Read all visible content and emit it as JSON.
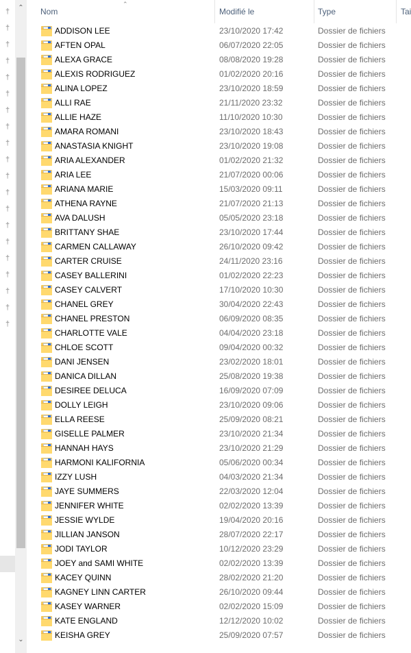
{
  "header": {
    "name": "Nom",
    "modified": "Modifié le",
    "type": "Type",
    "size": "Tail"
  },
  "icons": {
    "pin": "pin-icon",
    "scroll_up": "chevron-up-icon",
    "scroll_down": "chevron-down-icon",
    "folder": "folder-icon",
    "sort": "sort-ascending-icon"
  },
  "rows": [
    {
      "name": "ADDISON LEE",
      "date": "23/10/2020 17:42",
      "type": "Dossier de fichiers"
    },
    {
      "name": "AFTEN OPAL",
      "date": "06/07/2020 22:05",
      "type": "Dossier de fichiers"
    },
    {
      "name": "ALEXA GRACE",
      "date": "08/08/2020 19:28",
      "type": "Dossier de fichiers"
    },
    {
      "name": "ALEXIS RODRIGUEZ",
      "date": "01/02/2020 20:16",
      "type": "Dossier de fichiers"
    },
    {
      "name": "ALINA LOPEZ",
      "date": "23/10/2020 18:59",
      "type": "Dossier de fichiers"
    },
    {
      "name": "ALLI RAE",
      "date": "21/11/2020 23:32",
      "type": "Dossier de fichiers"
    },
    {
      "name": "ALLIE HAZE",
      "date": "11/10/2020 10:30",
      "type": "Dossier de fichiers"
    },
    {
      "name": "AMARA ROMANI",
      "date": "23/10/2020 18:43",
      "type": "Dossier de fichiers"
    },
    {
      "name": "ANASTASIA KNIGHT",
      "date": "23/10/2020 19:08",
      "type": "Dossier de fichiers"
    },
    {
      "name": "ARIA ALEXANDER",
      "date": "01/02/2020 21:32",
      "type": "Dossier de fichiers"
    },
    {
      "name": "ARIA LEE",
      "date": "21/07/2020 00:06",
      "type": "Dossier de fichiers"
    },
    {
      "name": "ARIANA MARIE",
      "date": "15/03/2020 09:11",
      "type": "Dossier de fichiers"
    },
    {
      "name": "ATHENA RAYNE",
      "date": "21/07/2020 21:13",
      "type": "Dossier de fichiers"
    },
    {
      "name": "AVA DALUSH",
      "date": "05/05/2020 23:18",
      "type": "Dossier de fichiers"
    },
    {
      "name": "BRITTANY SHAE",
      "date": "23/10/2020 17:44",
      "type": "Dossier de fichiers"
    },
    {
      "name": "CARMEN CALLAWAY",
      "date": "26/10/2020 09:42",
      "type": "Dossier de fichiers"
    },
    {
      "name": "CARTER CRUISE",
      "date": "24/11/2020 23:16",
      "type": "Dossier de fichiers"
    },
    {
      "name": "CASEY BALLERINI",
      "date": "01/02/2020 22:23",
      "type": "Dossier de fichiers"
    },
    {
      "name": "CASEY CALVERT",
      "date": "17/10/2020 10:30",
      "type": "Dossier de fichiers"
    },
    {
      "name": "CHANEL GREY",
      "date": "30/04/2020 22:43",
      "type": "Dossier de fichiers"
    },
    {
      "name": "CHANEL PRESTON",
      "date": "06/09/2020 08:35",
      "type": "Dossier de fichiers"
    },
    {
      "name": "CHARLOTTE VALE",
      "date": "04/04/2020 23:18",
      "type": "Dossier de fichiers"
    },
    {
      "name": "CHLOE SCOTT",
      "date": "09/04/2020 00:32",
      "type": "Dossier de fichiers"
    },
    {
      "name": "DANI JENSEN",
      "date": "23/02/2020 18:01",
      "type": "Dossier de fichiers"
    },
    {
      "name": "DANICA DILLAN",
      "date": "25/08/2020 19:38",
      "type": "Dossier de fichiers"
    },
    {
      "name": "DESIREE DELUCA",
      "date": "16/09/2020 07:09",
      "type": "Dossier de fichiers"
    },
    {
      "name": "DOLLY LEIGH",
      "date": "23/10/2020 09:06",
      "type": "Dossier de fichiers"
    },
    {
      "name": "ELLA REESE",
      "date": "25/09/2020 08:21",
      "type": "Dossier de fichiers"
    },
    {
      "name": "GISELLE PALMER",
      "date": "23/10/2020 21:34",
      "type": "Dossier de fichiers"
    },
    {
      "name": "HANNAH HAYS",
      "date": "23/10/2020 21:29",
      "type": "Dossier de fichiers"
    },
    {
      "name": "HARMONI KALIFORNIA",
      "date": "05/06/2020 00:34",
      "type": "Dossier de fichiers"
    },
    {
      "name": "IZZY LUSH",
      "date": "04/03/2020 21:34",
      "type": "Dossier de fichiers"
    },
    {
      "name": "JAYE SUMMERS",
      "date": "22/03/2020 12:04",
      "type": "Dossier de fichiers"
    },
    {
      "name": "JENNIFER WHITE",
      "date": "02/02/2020 13:39",
      "type": "Dossier de fichiers"
    },
    {
      "name": "JESSIE WYLDE",
      "date": "19/04/2020 20:16",
      "type": "Dossier de fichiers"
    },
    {
      "name": "JILLIAN JANSON",
      "date": "28/07/2020 22:17",
      "type": "Dossier de fichiers"
    },
    {
      "name": "JODI TAYLOR",
      "date": "10/12/2020 23:29",
      "type": "Dossier de fichiers"
    },
    {
      "name": "JOEY and SAMI WHITE",
      "date": "02/02/2020 13:39",
      "type": "Dossier de fichiers"
    },
    {
      "name": "KACEY QUINN",
      "date": "28/02/2020 21:20",
      "type": "Dossier de fichiers"
    },
    {
      "name": "KAGNEY LINN CARTER",
      "date": "26/10/2020 09:44",
      "type": "Dossier de fichiers"
    },
    {
      "name": "KASEY WARNER",
      "date": "02/02/2020 15:09",
      "type": "Dossier de fichiers"
    },
    {
      "name": "KATE ENGLAND",
      "date": "12/12/2020 10:02",
      "type": "Dossier de fichiers"
    },
    {
      "name": "KEISHA GREY",
      "date": "25/09/2020 07:57",
      "type": "Dossier de fichiers"
    }
  ]
}
